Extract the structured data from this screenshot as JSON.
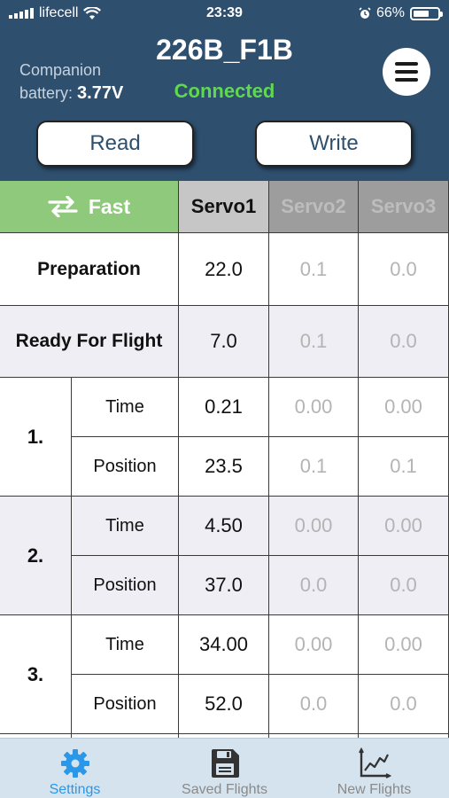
{
  "status_bar": {
    "carrier": "lifecell",
    "time": "23:39",
    "battery_percent": "66%",
    "battery_level": 0.66
  },
  "header": {
    "companion_label_1": "Companion",
    "companion_label_2": "battery:",
    "companion_voltage": "3.77V",
    "device_name": "226B_F1B",
    "connection_status": "Connected",
    "read_label": "Read",
    "write_label": "Write"
  },
  "table": {
    "mode_label": "Fast",
    "servo_headers": [
      "Servo1",
      "Servo2",
      "Servo3"
    ],
    "active_servo": "Servo1",
    "rows": {
      "preparation": {
        "label": "Preparation",
        "values": [
          "22.0",
          "0.1",
          "0.0"
        ]
      },
      "ready": {
        "label": "Ready For Flight",
        "values": [
          "7.0",
          "0.1",
          "0.0"
        ]
      }
    },
    "steps": [
      {
        "number": "1.",
        "time_label": "Time",
        "time": [
          "0.21",
          "0.00",
          "0.00"
        ],
        "position_label": "Position",
        "position": [
          "23.5",
          "0.1",
          "0.1"
        ]
      },
      {
        "number": "2.",
        "time_label": "Time",
        "time": [
          "4.50",
          "0.00",
          "0.00"
        ],
        "position_label": "Position",
        "position": [
          "37.0",
          "0.0",
          "0.0"
        ]
      },
      {
        "number": "3.",
        "time_label": "Time",
        "time": [
          "34.00",
          "0.00",
          "0.00"
        ],
        "position_label": "Position",
        "position": [
          "52.0",
          "0.0",
          "0.0"
        ]
      }
    ]
  },
  "tabbar": {
    "tabs": [
      {
        "label": "Settings",
        "icon": "gear-icon",
        "active": true
      },
      {
        "label": "Saved Flights",
        "icon": "floppy-disk-icon",
        "active": false
      },
      {
        "label": "New Flights",
        "icon": "line-chart-icon",
        "active": false
      }
    ]
  },
  "colors": {
    "header_bg": "#2e4f6e",
    "connected": "#5fd94f",
    "mode_bg": "#8fc97b",
    "tab_active": "#2a97e8",
    "tabbar_bg": "#d4e3ee"
  }
}
